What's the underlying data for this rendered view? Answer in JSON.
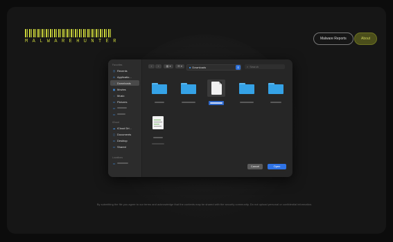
{
  "app": {
    "logo_text": "MALWAREHUNTER",
    "header_buttons": {
      "reports": "Malware Reports",
      "about": "About"
    },
    "footer_text": "By submitting the file you agree to our terms and acknowledge that the contents may be shared with the security community. Do not upload personal or confidential information."
  },
  "dialog": {
    "toolbar": {
      "back_icon": "chevron-left-icon",
      "forward_icon": "chevron-right-icon",
      "view_label": "▦ ▾",
      "group_label": "☰ ▾",
      "location_label": "Downloads",
      "search_placeholder": "Search"
    },
    "sidebar": {
      "favorites_heading": "Favorites",
      "favorites": [
        {
          "label": "Recents",
          "icon": "clock-icon"
        },
        {
          "label": "Applicatio...",
          "icon": "apps-icon"
        },
        {
          "label": "Downloads",
          "icon": "download-icon",
          "selected": true
        },
        {
          "label": "Movies",
          "icon": "film-icon"
        },
        {
          "label": "Music",
          "icon": "music-icon"
        },
        {
          "label": "Pictures",
          "icon": "photo-icon"
        }
      ],
      "icloud_heading": "iCloud",
      "icloud": [
        {
          "label": "iCloud Dri...",
          "icon": "cloud-icon"
        },
        {
          "label": "Documents",
          "icon": "document-icon"
        },
        {
          "label": "Desktop",
          "icon": "desktop-icon"
        },
        {
          "label": "Shared",
          "icon": "shared-folder-icon"
        }
      ],
      "locations_heading": "Locations"
    },
    "files": [
      {
        "type": "folder"
      },
      {
        "type": "folder"
      },
      {
        "type": "document",
        "selected": true
      },
      {
        "type": "folder"
      },
      {
        "type": "folder"
      },
      {
        "type": "image"
      }
    ],
    "buttons": {
      "cancel": "Cancel",
      "open": "Open"
    }
  }
}
